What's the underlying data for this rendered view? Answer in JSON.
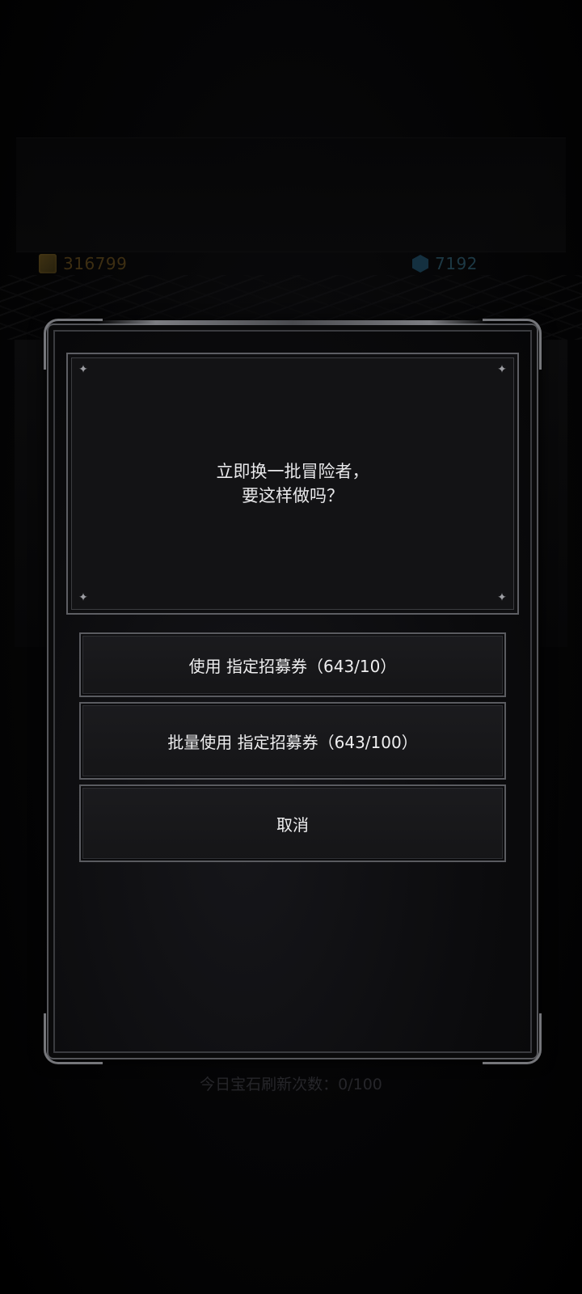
{
  "resources": {
    "gold": {
      "icon": "gold-coin-icon",
      "value": "316799"
    },
    "gem": {
      "icon": "gem-icon",
      "value": "7192"
    }
  },
  "dialog": {
    "message_line1": "立即换一批冒险者，",
    "message_line2": "要这样做吗？",
    "buttons": {
      "use_single": "使用 指定招募券（643/10）",
      "use_batch": "批量使用 指定招募券（643/100）",
      "cancel": "取消"
    }
  },
  "footer": {
    "gem_refresh_count": "今日宝石刷新次数：0/100"
  },
  "colors": {
    "background": "#000000",
    "panel": "#131315",
    "border": "#5a5b60",
    "text": "#e8e8ea"
  }
}
